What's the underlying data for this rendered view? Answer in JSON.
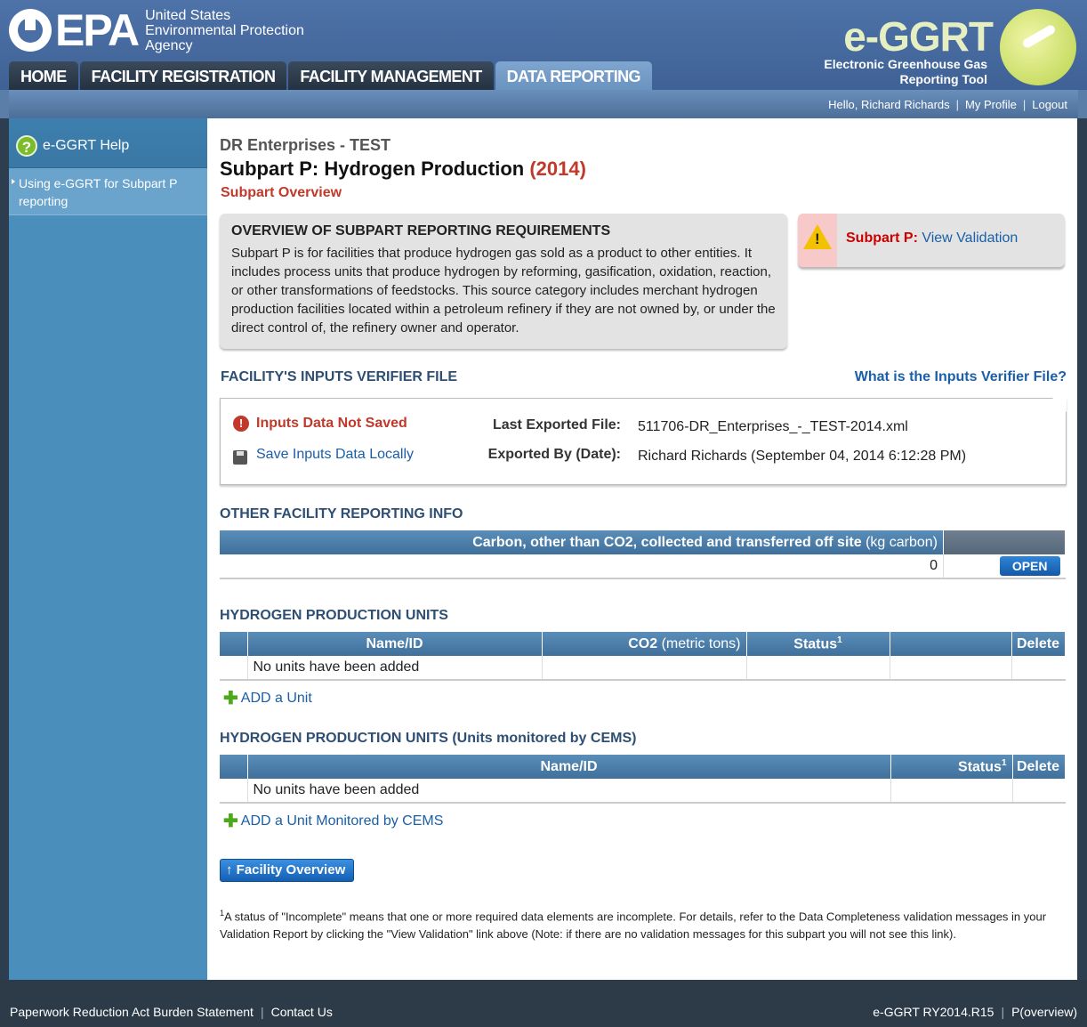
{
  "header": {
    "epa_letters": "EPA",
    "agency_line1": "United States",
    "agency_line2": "Environmental Protection",
    "agency_line3": "Agency",
    "brand_title": "e-GGRT",
    "brand_sub1": "Electronic Greenhouse Gas",
    "brand_sub2": "Reporting Tool",
    "tabs": [
      "HOME",
      "FACILITY REGISTRATION",
      "FACILITY MANAGEMENT",
      "DATA REPORTING"
    ],
    "active_tab": "DATA REPORTING"
  },
  "userbar": {
    "greeting": "Hello, Richard Richards",
    "profile": "My Profile",
    "logout": "Logout"
  },
  "sidebar": {
    "help_title": "e-GGRT Help",
    "help_icon": "question-icon",
    "items": [
      "Using e-GGRT for Subpart P reporting"
    ]
  },
  "main": {
    "facility_name": "DR Enterprises - TEST",
    "title": "Subpart P: Hydrogen Production",
    "year": "(2014)",
    "subtitle": "Subpart Overview",
    "overview": {
      "heading": "OVERVIEW OF SUBPART REPORTING REQUIREMENTS",
      "text": "Subpart P is for facilities that produce hydrogen gas sold as a product to other entities. It includes process units that produce hydrogen by reforming, gasification, oxidation, reaction, or other transformations of feedstocks. This source category includes merchant hydrogen production facilities located within a petroleum refinery if they are not owned by, or under the direct control of, the refinery owner and operator."
    },
    "validation": {
      "label": "Subpart P:",
      "link": "View Validation",
      "icon": "warning-icon"
    },
    "verifier": {
      "heading": "FACILITY'S INPUTS VERIFIER FILE",
      "help_link": "What is the Inputs Verifier File?",
      "not_saved": "Inputs Data Not Saved",
      "save_local": "Save Inputs Data Locally",
      "last_exported_label": "Last Exported File:",
      "last_exported_value": "511706-DR_Enterprises_-_TEST-2014.xml",
      "exported_by_label": "Exported By (Date):",
      "exported_by_value": "Richard Richards (September 04, 2014 6:12:28 PM)"
    },
    "other_info": {
      "heading": "OTHER FACILITY REPORTING INFO",
      "column": "Carbon, other than CO2, collected and transferred off site",
      "column_unit": "(kg carbon)",
      "value": "0",
      "open_label": "OPEN"
    },
    "units": {
      "heading": "HYDROGEN PRODUCTION UNITS",
      "columns": [
        "Name/ID",
        "CO2",
        "(metric tons)",
        "Status",
        "1",
        "Delete"
      ],
      "empty": "No units have been added",
      "add_label": "ADD a Unit"
    },
    "cems": {
      "heading": "HYDROGEN PRODUCTION UNITS (Units monitored by CEMS)",
      "columns": [
        "Name/ID",
        "Status",
        "1",
        "Delete"
      ],
      "empty": "No units have been added",
      "add_label": "ADD a Unit Monitored by CEMS"
    },
    "facility_overview_btn": "Facility Overview",
    "footnote_mark": "1",
    "footnote": "A status of \"Incomplete\" means that one or more required data elements are incomplete. For details, refer to the Data Completeness validation messages in your Validation Report by clicking the \"View Validation\" link above (Note: if there are no validation messages for this subpart you will not see this link)."
  },
  "footer": {
    "burden": "Paperwork Reduction Act Burden Statement",
    "contact": "Contact Us",
    "version": "e-GGRT RY2014.R15",
    "page_id": "P(overview)"
  }
}
